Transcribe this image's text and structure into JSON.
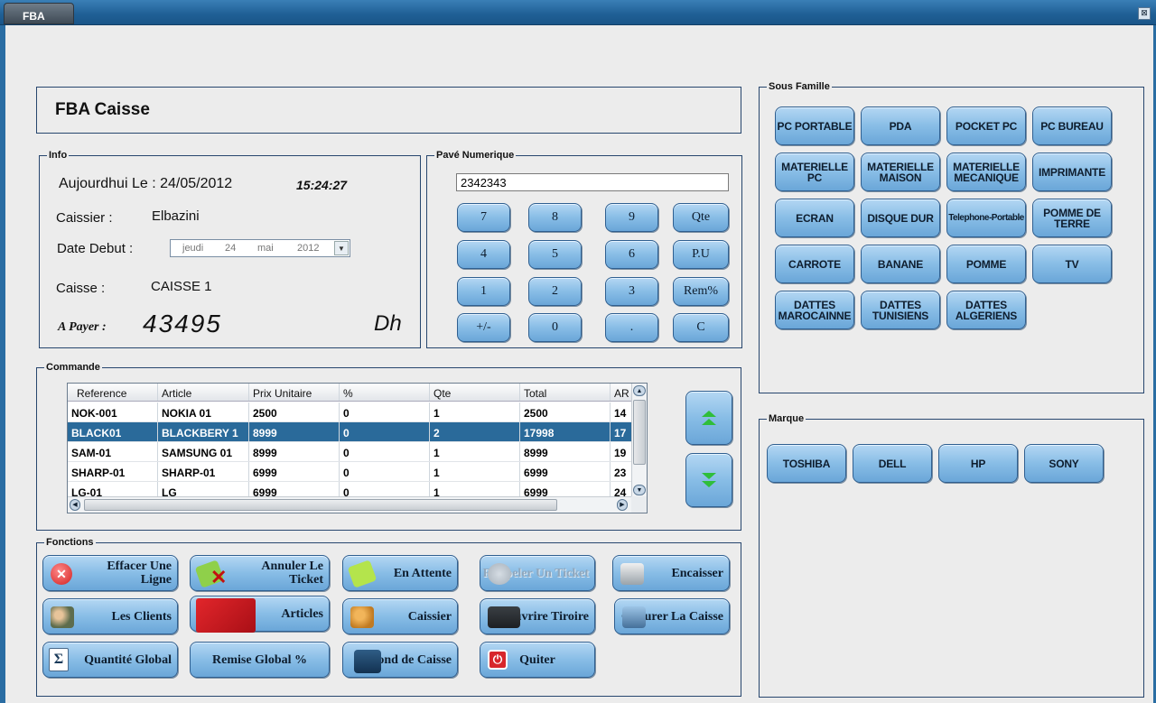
{
  "window": {
    "title": "FBA",
    "close_glyph": "⊠"
  },
  "header": {
    "title": "FBA Caisse"
  },
  "info": {
    "group_title": "Info",
    "date_label": "Aujourdhui Le : 24/05/2012",
    "time": "15:24:27",
    "cashier_label": "Caissier :",
    "cashier_value": "Elbazini",
    "start_date_label": "Date Debut :",
    "start_date": {
      "weekday": "jeudi",
      "day": "24",
      "month": "mai",
      "year": "2012"
    },
    "register_label": "Caisse :",
    "register_value": "CAISSE 1",
    "to_pay_label": "A Payer :",
    "to_pay_value": "43495",
    "currency": "Dh"
  },
  "numpad": {
    "group_title": "Pavé Numerique",
    "input_value": "2342343",
    "rows": [
      [
        "7",
        "8",
        "9",
        "Qte"
      ],
      [
        "4",
        "5",
        "6",
        "P.U"
      ],
      [
        "1",
        "2",
        "3",
        "Rem%"
      ],
      [
        "+/-",
        "0",
        ".",
        "C"
      ]
    ]
  },
  "order": {
    "group_title": "Commande",
    "columns": [
      "Reference",
      "Article",
      "Prix Unitaire",
      "%",
      "Qte",
      "Total",
      "AR"
    ],
    "rows": [
      [
        "NOK-001",
        "NOKIA 01",
        "2500",
        "0",
        "1",
        "2500",
        "14"
      ],
      [
        "BLACK01",
        "BLACKBERY 1",
        "8999",
        "0",
        "2",
        "17998",
        "17"
      ],
      [
        "SAM-01",
        "SAMSUNG 01",
        "8999",
        "0",
        "1",
        "8999",
        "19"
      ],
      [
        "SHARP-01",
        "SHARP-01",
        "6999",
        "0",
        "1",
        "6999",
        "23"
      ],
      [
        "LG-01",
        "LG",
        "6999",
        "0",
        "1",
        "6999",
        "24"
      ]
    ],
    "selected_row": 1
  },
  "functions": {
    "group_title": "Fonctions",
    "buttons": {
      "effacer": "Effacer Une Ligne",
      "annuler": "Annuler Le Ticket",
      "attente": "En Attente",
      "rappeler": "Rappeler Un Ticket",
      "encaisser": "Encaisser",
      "clients": "Les Clients",
      "articles": "Articles",
      "caissier": "Caissier",
      "tiroire": "Ouvrire Tiroire",
      "cloturer": "Cloturer La Caisse",
      "quantite": "Quantité Global",
      "remise": "Remise Global %",
      "fond": "Fond de Caisse",
      "quiter": "Quiter"
    }
  },
  "sous_famille": {
    "group_title": "Sous Famille",
    "items": [
      "PC PORTABLE",
      "PDA",
      "POCKET PC",
      "PC BUREAU",
      "MATERIELLE PC",
      "MATERIELLE MAISON",
      "MATERIELLE MECANIQUE",
      "IMPRIMANTE",
      "ECRAN",
      "DISQUE DUR",
      "Telephone-Portable",
      "POMME DE TERRE",
      "CARROTE",
      "BANANE",
      "POMME",
      "TV",
      "DATTES MAROCAINNE",
      "DATTES TUNISIENS",
      "DATTES ALGERIENS"
    ]
  },
  "marque": {
    "group_title": "Marque",
    "items": [
      "TOSHIBA",
      "DELL",
      "HP",
      "SONY"
    ]
  },
  "colors": {
    "titlebar": "#1f5f95",
    "button_top": "#b4d7f3",
    "button_bottom": "#6aa6d8",
    "selected_row": "#2a6a9a"
  }
}
